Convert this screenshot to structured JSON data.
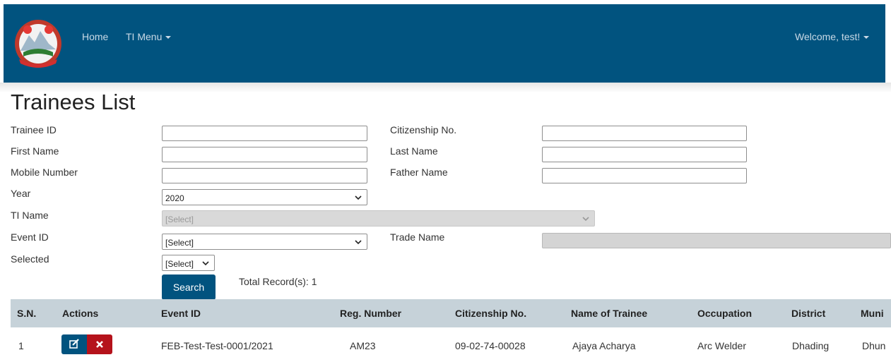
{
  "nav": {
    "home": "Home",
    "ti_menu": "TI Menu",
    "welcome": "Welcome, test!"
  },
  "page": {
    "title": "Trainees List"
  },
  "form": {
    "trainee_id": {
      "label": "Trainee ID",
      "value": ""
    },
    "citizenship_no": {
      "label": "Citizenship No.",
      "value": ""
    },
    "first_name": {
      "label": "First Name",
      "value": ""
    },
    "last_name": {
      "label": "Last Name",
      "value": ""
    },
    "mobile_number": {
      "label": "Mobile Number",
      "value": ""
    },
    "father_name": {
      "label": "Father Name",
      "value": ""
    },
    "year": {
      "label": "Year",
      "value": "2020"
    },
    "ti_name": {
      "label": "TI Name",
      "value": "[Select]"
    },
    "event_id": {
      "label": "Event ID",
      "value": "[Select]"
    },
    "trade_name": {
      "label": "Trade Name",
      "value": ""
    },
    "selected": {
      "label": "Selected",
      "value": "[Select]"
    },
    "search_label": "Search",
    "total_records": "Total Record(s): 1"
  },
  "table": {
    "headers": [
      "S.N.",
      "Actions",
      "Event ID",
      "Reg. Number",
      "Citizenship No.",
      "Name of Trainee",
      "Occupation",
      "District",
      "Muni"
    ],
    "rows": [
      [
        "1",
        "",
        "FEB-Test-Test-0001/2021",
        "AM23",
        "09-02-74-00028",
        "Ajaya Acharya",
        "Arc Welder",
        "Dhading",
        "Dhun"
      ]
    ]
  },
  "colors": {
    "nav_bg": "#01537f",
    "edit_btn": "#01537f",
    "delete_btn": "#b5121b",
    "table_header": "#c6d2d9"
  }
}
